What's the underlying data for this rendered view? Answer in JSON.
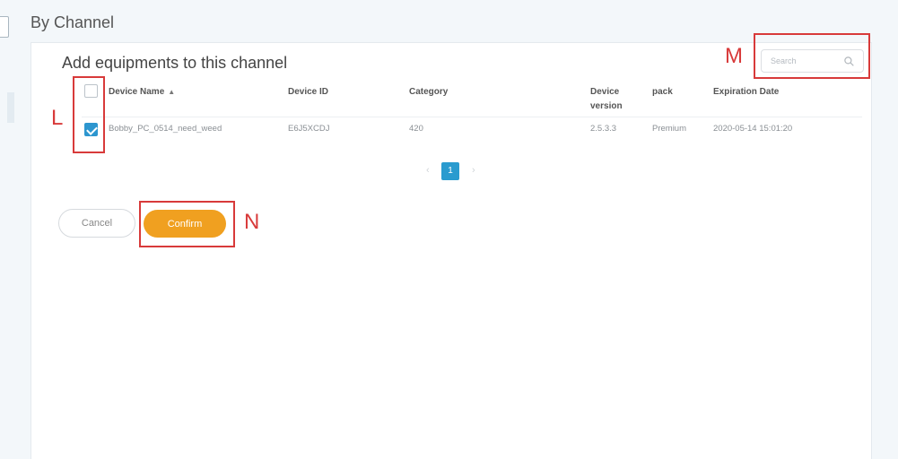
{
  "page": {
    "section_title": "By Channel"
  },
  "panel": {
    "title": "Add equipments to this channel",
    "search": {
      "placeholder": "Search"
    },
    "columns": {
      "device_name": "Device Name",
      "device_id": "Device ID",
      "category": "Category",
      "device_version_line1": "Device",
      "device_version_line2": "version",
      "pack": "pack",
      "expiration_date": "Expiration Date"
    },
    "rows": [
      {
        "checked": true,
        "device_name": "Bobby_PC_0514_need_weed",
        "device_id": "E6J5XCDJ",
        "category": "420",
        "device_version": "2.5.3.3",
        "pack": "Premium",
        "expiration_date": "2020-05-14 15:01:20"
      }
    ],
    "pagination": {
      "current": "1",
      "prev_arrow": "‹",
      "next_arrow": "›"
    },
    "buttons": {
      "cancel": "Cancel",
      "confirm": "Confirm"
    }
  },
  "annotations": {
    "L": "L",
    "M": "M",
    "N": "N"
  },
  "colors": {
    "annotation": "#d83a3a",
    "confirm": "#f0a020",
    "accent": "#2a9bcf"
  },
  "icons": {
    "search": "search-icon",
    "sort": "sort-asc-icon",
    "checkmark": "checkmark-icon"
  }
}
